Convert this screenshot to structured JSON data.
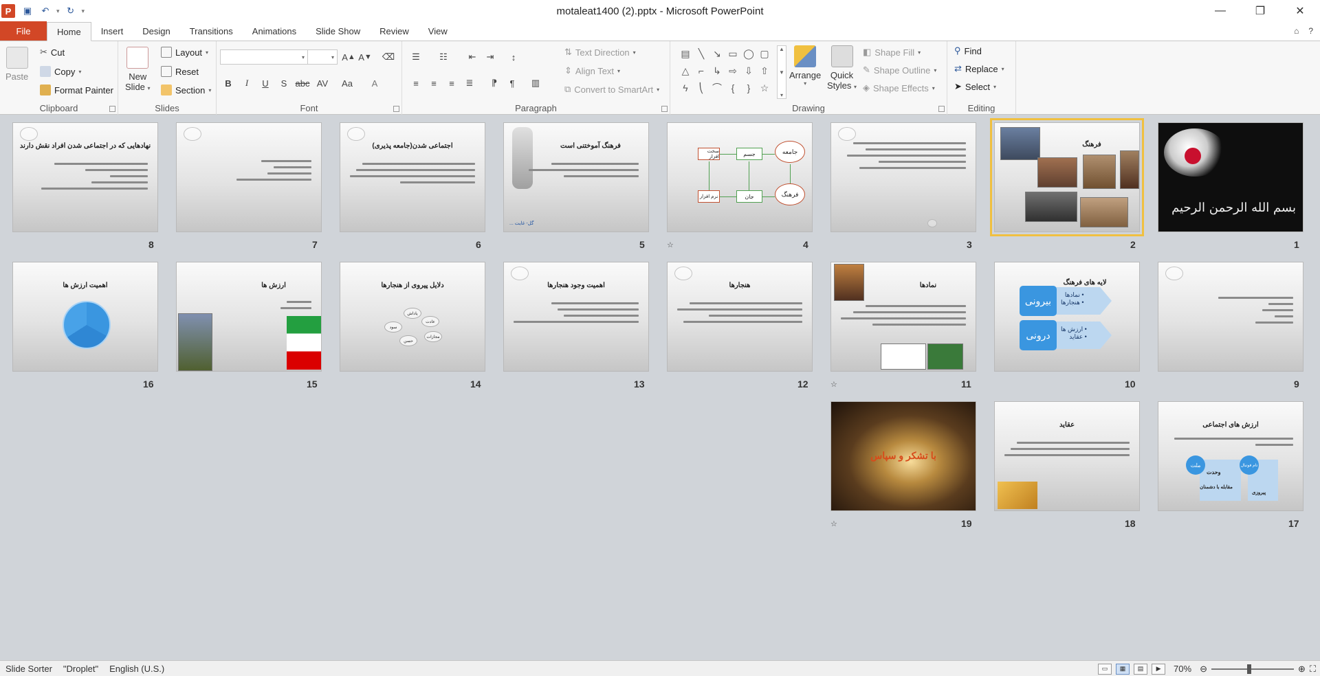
{
  "window": {
    "title": "motaleat1400 (2).pptx - Microsoft PowerPoint",
    "app_letter": "P"
  },
  "tabs": {
    "file": "File",
    "items": [
      "Home",
      "Insert",
      "Design",
      "Transitions",
      "Animations",
      "Slide Show",
      "Review",
      "View"
    ],
    "active": "Home"
  },
  "ribbon": {
    "clipboard": {
      "label": "Clipboard",
      "paste": "Paste",
      "cut": "Cut",
      "copy": "Copy",
      "format_painter": "Format Painter"
    },
    "slides": {
      "label": "Slides",
      "new_slide_line1": "New",
      "new_slide_line2": "Slide",
      "layout": "Layout",
      "reset": "Reset",
      "section": "Section"
    },
    "font": {
      "label": "Font",
      "font_name": "",
      "font_size": ""
    },
    "paragraph": {
      "label": "Paragraph",
      "text_direction": "Text Direction",
      "align_text": "Align Text",
      "convert_smartart": "Convert to SmartArt"
    },
    "drawing": {
      "label": "Drawing",
      "arrange": "Arrange",
      "quick_styles_line1": "Quick",
      "quick_styles_line2": "Styles",
      "shape_fill": "Shape Fill",
      "shape_outline": "Shape Outline",
      "shape_effects": "Shape Effects"
    },
    "editing": {
      "label": "Editing",
      "find": "Find",
      "replace": "Replace",
      "select": "Select"
    }
  },
  "slides": [
    {
      "num": "1",
      "title": ""
    },
    {
      "num": "2",
      "title": "فرهنگ"
    },
    {
      "num": "3",
      "title": ""
    },
    {
      "num": "4",
      "title": ""
    },
    {
      "num": "5",
      "title": "فرهنگ آموختنی است"
    },
    {
      "num": "6",
      "title": "اجتماعی شدن(جامعه پذیری)"
    },
    {
      "num": "7",
      "title": ""
    },
    {
      "num": "8",
      "title": "نهادهایی که در اجتماعی شدن افراد نقش دارند"
    },
    {
      "num": "9",
      "title": ""
    },
    {
      "num": "10",
      "title": "لایه های فرهنگ"
    },
    {
      "num": "11",
      "title": "نمادها"
    },
    {
      "num": "12",
      "title": "هنجارها"
    },
    {
      "num": "13",
      "title": "اهمیت وجود هنجارها"
    },
    {
      "num": "14",
      "title": "دلایل پیروی از هنجارها"
    },
    {
      "num": "15",
      "title": "ارزش ها"
    },
    {
      "num": "16",
      "title": "اهمیت ارزش ها"
    },
    {
      "num": "17",
      "title": "ارزش های اجتماعی"
    },
    {
      "num": "18",
      "title": "عقاید"
    },
    {
      "num": "19",
      "title": "با تشکر و سپاس"
    }
  ],
  "slide4": {
    "n1": "جامعه",
    "n2": "جسم",
    "n3": "سخت افزار",
    "n4": "فرهنگ",
    "n5": "جان",
    "n6": "نرم افزار"
  },
  "slide10": {
    "outer": "بیرونی",
    "inner": "درونی",
    "outer_items": "• نمادها\n• هنجارها",
    "inner_items": "• ارزش ها\n• عقاید"
  },
  "slide17": {
    "b1": "ملت",
    "b2": "تام فوتبال",
    "t1": "وحدت",
    "t2": "مقابله با دشمنان",
    "t3": "پیروزی"
  },
  "slide14": {
    "p1": "پاداش",
    "p2": "عادت",
    "p3": "مجازات",
    "p4": "سود",
    "p5": "حسن"
  },
  "slide5": {
    "caption": "گل- غایت ..."
  },
  "slide1": {
    "calligraphy": "بسم الله الرحمن الرحیم"
  },
  "statusbar": {
    "view": "Slide Sorter",
    "theme": "\"Droplet\"",
    "language": "English (U.S.)",
    "zoom": "70%"
  }
}
